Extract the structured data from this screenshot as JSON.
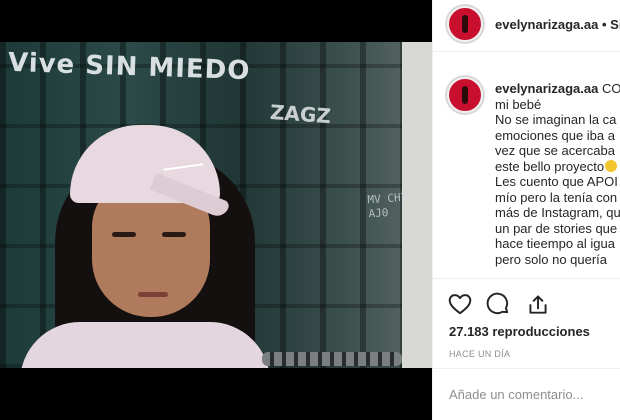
{
  "post": {
    "username": "evelynarizaga.aa",
    "header_separator": "•",
    "follow_label": "Si",
    "caption_lines": [
      "CO",
      "mi bebé",
      "No se imaginan la ca",
      "emociones que iba a",
      "vez que se acercaba",
      "este bello proyecto",
      "Les cuento que APOI",
      "mío pero la tenía con",
      "más de Instagram, qu",
      "un par de stories que",
      "hace tieempo al igua",
      "pero solo no quería"
    ],
    "views": "27.183 reproducciones",
    "time_ago": "HACE UN DÍA",
    "comment_placeholder": "Añade un comentario..."
  },
  "video": {
    "graffiti_main": "Vive SIN MIEDO",
    "graffiti_tag": "ZAGZ",
    "graffiti_side": "MV CH7 AJ0"
  },
  "icons": {
    "like": "heart-icon",
    "comment": "comment-icon",
    "share": "share-icon",
    "emoji": "emoji-icon"
  },
  "colors": {
    "text": "#262626",
    "muted": "#8e8e8e",
    "border": "#efefef",
    "avatar_bg": "#c8102e"
  }
}
